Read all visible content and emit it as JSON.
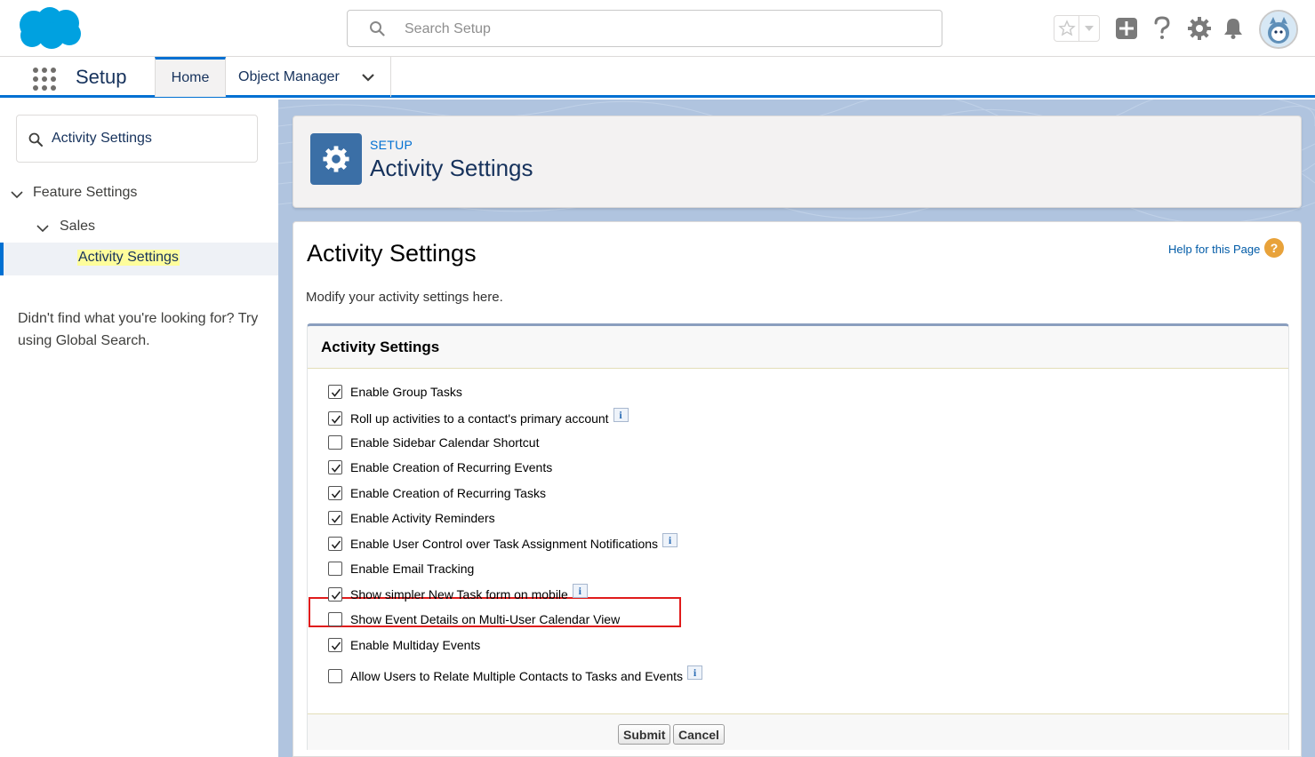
{
  "header": {
    "search_placeholder": "Search Setup"
  },
  "context_bar": {
    "app_name": "Setup",
    "tabs": [
      {
        "label": "Home",
        "active": true
      },
      {
        "label": "Object Manager",
        "active": false
      }
    ]
  },
  "sidebar": {
    "quick_find_value": "Activity Settings",
    "tree": [
      {
        "label": "Feature Settings",
        "expanded": true
      },
      {
        "label": "Sales",
        "expanded": true
      },
      {
        "label": "Activity Settings",
        "selected": true
      }
    ],
    "help_text": "Didn't find what you're looking for? Try using Global Search."
  },
  "page_header": {
    "eyebrow": "SETUP",
    "title": "Activity Settings"
  },
  "content": {
    "title": "Activity Settings",
    "help_link": "Help for this Page",
    "description": "Modify your activity settings here.",
    "section_title": "Activity Settings",
    "options": [
      {
        "label": "Enable Group Tasks",
        "checked": true,
        "info": false
      },
      {
        "label": "Roll up activities to a contact's primary account",
        "checked": true,
        "info": true
      },
      {
        "label": "Enable Sidebar Calendar Shortcut",
        "checked": false,
        "info": false
      },
      {
        "label": "Enable Creation of Recurring Events",
        "checked": true,
        "info": false
      },
      {
        "label": "Enable Creation of Recurring Tasks",
        "checked": true,
        "info": false
      },
      {
        "label": "Enable Activity Reminders",
        "checked": true,
        "info": false
      },
      {
        "label": "Enable User Control over Task Assignment Notifications",
        "checked": true,
        "info": true
      },
      {
        "label": "Enable Email Tracking",
        "checked": false,
        "info": false,
        "highlighted": true
      },
      {
        "label": "Show simpler New Task form on mobile",
        "checked": true,
        "info": true
      },
      {
        "label": "Show Event Details on Multi-User Calendar View",
        "checked": false,
        "info": false
      },
      {
        "label": "Enable Multiday Events",
        "checked": true,
        "info": false
      },
      {
        "label": "Allow Users to Relate Multiple Contacts to Tasks and Events",
        "checked": false,
        "info": true
      }
    ],
    "info_glyph": "i",
    "help_glyph": "?",
    "submit_label": "Submit",
    "cancel_label": "Cancel"
  },
  "colors": {
    "brand_blue": "#0070d2",
    "logo_blue": "#00a1e0",
    "page_icon_bg": "#3b6fa6",
    "highlight_border": "#e01b1b",
    "search_match_bg": "#fefd9c"
  }
}
